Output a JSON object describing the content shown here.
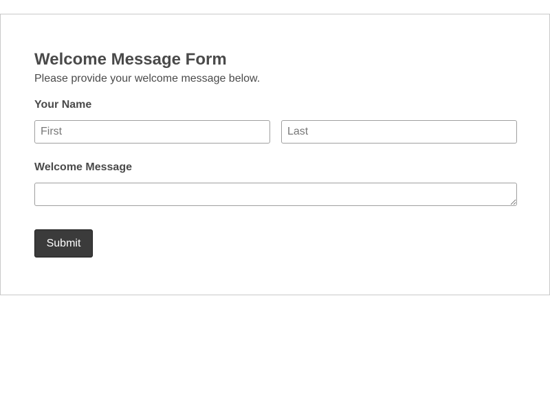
{
  "form": {
    "title": "Welcome Message Form",
    "subtitle": "Please provide your welcome message below.",
    "name_label": "Your Name",
    "first_placeholder": "First",
    "last_placeholder": "Last",
    "message_label": "Welcome Message",
    "message_placeholder": "",
    "submit_label": "Submit"
  }
}
